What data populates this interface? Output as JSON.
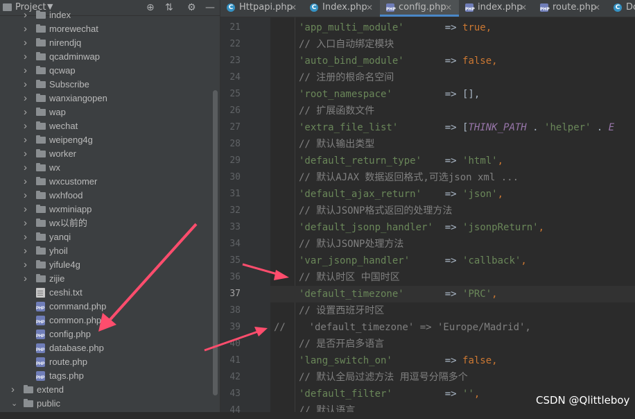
{
  "project_panel": {
    "title": "Project",
    "tree": [
      {
        "label": "index",
        "type": "folder",
        "expanded": false
      },
      {
        "label": "morewechat",
        "type": "folder",
        "expanded": false
      },
      {
        "label": "nirendjq",
        "type": "folder",
        "expanded": false
      },
      {
        "label": "qcadminwap",
        "type": "folder",
        "expanded": false
      },
      {
        "label": "qcwap",
        "type": "folder",
        "expanded": false
      },
      {
        "label": "Subscribe",
        "type": "folder",
        "expanded": false
      },
      {
        "label": "wanxiangopen",
        "type": "folder",
        "expanded": false
      },
      {
        "label": "wap",
        "type": "folder",
        "expanded": false
      },
      {
        "label": "wechat",
        "type": "folder",
        "expanded": false
      },
      {
        "label": "weipeng4g",
        "type": "folder",
        "expanded": false
      },
      {
        "label": "worker",
        "type": "folder",
        "expanded": false
      },
      {
        "label": "wx",
        "type": "folder",
        "expanded": false
      },
      {
        "label": "wxcustomer",
        "type": "folder",
        "expanded": false
      },
      {
        "label": "wxhfood",
        "type": "folder",
        "expanded": false
      },
      {
        "label": "wxminiapp",
        "type": "folder",
        "expanded": false
      },
      {
        "label": "wx以前的",
        "type": "folder",
        "expanded": false
      },
      {
        "label": "yanqi",
        "type": "folder",
        "expanded": false
      },
      {
        "label": "yhoil",
        "type": "folder",
        "expanded": false
      },
      {
        "label": "yifule4g",
        "type": "folder",
        "expanded": false
      },
      {
        "label": "zijie",
        "type": "folder",
        "expanded": false
      },
      {
        "label": "ceshi.txt",
        "type": "txt"
      },
      {
        "label": "command.php",
        "type": "php"
      },
      {
        "label": "common.php",
        "type": "php"
      },
      {
        "label": "config.php",
        "type": "php"
      },
      {
        "label": "database.php",
        "type": "php"
      },
      {
        "label": "route.php",
        "type": "php"
      },
      {
        "label": "tags.php",
        "type": "php"
      },
      {
        "label": "extend",
        "type": "folder",
        "expanded": false,
        "root": true
      },
      {
        "label": "public",
        "type": "folder",
        "expanded": true,
        "root": true
      }
    ]
  },
  "tabs": [
    {
      "label": "Httpapi.php",
      "icon": "class-icon",
      "active": false
    },
    {
      "label": "Index.php",
      "icon": "class-icon",
      "active": false
    },
    {
      "label": "config.php",
      "icon": "php-file-icon",
      "active": true
    },
    {
      "label": "index.php",
      "icon": "php-file-icon",
      "active": false
    },
    {
      "label": "route.php",
      "icon": "php-file-icon",
      "active": false
    },
    {
      "label": "Do",
      "icon": "class-icon",
      "active": false
    }
  ],
  "editor": {
    "current_line": "37",
    "lines": [
      {
        "n": "21",
        "parts": [
          [
            "s",
            "'app_multi_module'"
          ],
          [
            "op",
            "       => "
          ],
          [
            "kw",
            "true,"
          ]
        ]
      },
      {
        "n": "22",
        "parts": [
          [
            "cm",
            "// 入口自动绑定模块"
          ]
        ]
      },
      {
        "n": "23",
        "parts": [
          [
            "s",
            "'auto_bind_module'"
          ],
          [
            "op",
            "       => "
          ],
          [
            "kw",
            "false,"
          ]
        ]
      },
      {
        "n": "24",
        "parts": [
          [
            "cm",
            "// 注册的根命名空间"
          ]
        ]
      },
      {
        "n": "25",
        "parts": [
          [
            "s",
            "'root_namespace'"
          ],
          [
            "op",
            "         => [],"
          ]
        ]
      },
      {
        "n": "26",
        "parts": [
          [
            "cm",
            "// 扩展函数文件"
          ]
        ]
      },
      {
        "n": "27",
        "parts": [
          [
            "s",
            "'extra_file_list'"
          ],
          [
            "op",
            "        => ["
          ],
          [
            "const",
            "THINK_PATH"
          ],
          [
            "op",
            " . "
          ],
          [
            "s",
            "'helper'"
          ],
          [
            "op",
            " . "
          ],
          [
            "const",
            "E"
          ]
        ]
      },
      {
        "n": "28",
        "parts": [
          [
            "cm",
            "// 默认输出类型"
          ]
        ]
      },
      {
        "n": "29",
        "parts": [
          [
            "s",
            "'default_return_type'"
          ],
          [
            "op",
            "    => "
          ],
          [
            "s",
            "'html'"
          ],
          [
            "kw",
            ","
          ]
        ]
      },
      {
        "n": "30",
        "parts": [
          [
            "cm",
            "// 默认AJAX 数据返回格式,可选json xml ..."
          ]
        ]
      },
      {
        "n": "31",
        "parts": [
          [
            "s",
            "'default_ajax_return'"
          ],
          [
            "op",
            "    => "
          ],
          [
            "s",
            "'json'"
          ],
          [
            "kw",
            ","
          ]
        ]
      },
      {
        "n": "32",
        "parts": [
          [
            "cm",
            "// 默认JSONP格式返回的处理方法"
          ]
        ]
      },
      {
        "n": "33",
        "parts": [
          [
            "s",
            "'default_jsonp_handler'"
          ],
          [
            "op",
            "  => "
          ],
          [
            "s",
            "'jsonpReturn'"
          ],
          [
            "kw",
            ","
          ]
        ]
      },
      {
        "n": "34",
        "parts": [
          [
            "cm",
            "// 默认JSONP处理方法"
          ]
        ]
      },
      {
        "n": "35",
        "parts": [
          [
            "s",
            "'var_jsonp_handler'"
          ],
          [
            "op",
            "      => "
          ],
          [
            "s",
            "'callback'"
          ],
          [
            "kw",
            ","
          ]
        ]
      },
      {
        "n": "36",
        "parts": [
          [
            "cm",
            "// 默认时区 中国时区"
          ]
        ]
      },
      {
        "n": "37",
        "parts": [
          [
            "s",
            "'default_timezone'"
          ],
          [
            "op",
            "       => "
          ],
          [
            "s",
            "'PRC'"
          ],
          [
            "kw",
            ","
          ]
        ]
      },
      {
        "n": "38",
        "parts": [
          [
            "cm",
            "// 设置西班牙时区"
          ]
        ]
      },
      {
        "n": "39",
        "noindent": true,
        "parts": [
          [
            "cm",
            "//    'default_timezone' => 'Europe/Madrid',"
          ]
        ]
      },
      {
        "n": "40",
        "parts": [
          [
            "cm",
            "// 是否开启多语言"
          ]
        ]
      },
      {
        "n": "41",
        "parts": [
          [
            "s",
            "'lang_switch_on'"
          ],
          [
            "op",
            "         => "
          ],
          [
            "kw",
            "false,"
          ]
        ]
      },
      {
        "n": "42",
        "parts": [
          [
            "cm",
            "// 默认全局过滤方法 用逗号分隔多个"
          ]
        ]
      },
      {
        "n": "43",
        "parts": [
          [
            "s",
            "'default_filter'"
          ],
          [
            "op",
            "         => "
          ],
          [
            "s",
            "''"
          ],
          [
            "kw",
            ","
          ]
        ]
      },
      {
        "n": "44",
        "parts": [
          [
            "cm",
            "// 默认语言"
          ]
        ]
      }
    ]
  },
  "watermark": "CSDN @Qlittleboy",
  "colors": {
    "annotation_arrow": "#ff4d6d",
    "active_tab_underline": "#4a88c7",
    "string": "#6a8759",
    "keyword": "#cc7832",
    "comment": "#808080"
  }
}
